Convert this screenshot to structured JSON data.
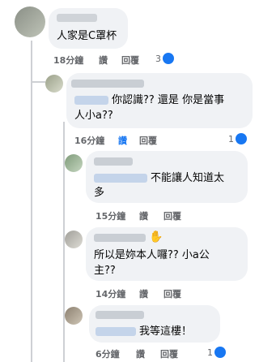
{
  "comments": [
    {
      "text": "人家是C罩杯",
      "time": "18分鐘",
      "like": "讚",
      "reply": "回覆",
      "reactions": "3"
    },
    {
      "text": "你認識?? 還是 你是當事人小a??",
      "line1": "你認識?? 還是 你是當事",
      "line2": "人小a??",
      "time": "16分鐘",
      "like": "讚",
      "reply": "回覆",
      "reactions": "1"
    },
    {
      "line1": "不能讓人知道太",
      "line2": "多",
      "time": "15分鐘",
      "like": "讚",
      "reply": "回覆"
    },
    {
      "line1": "所以是妳本人囉?? 小a公",
      "line2": "主??",
      "time": "14分鐘",
      "like": "讚",
      "reply": "回覆"
    },
    {
      "line1": "我等這樓！",
      "time": "6分鐘",
      "like": "讚",
      "reply": "回覆",
      "reactions": "1"
    }
  ],
  "colors": {
    "like_blue": "#1877f2",
    "bubble": "#f0f2f5",
    "meta_gray": "#65676b"
  }
}
